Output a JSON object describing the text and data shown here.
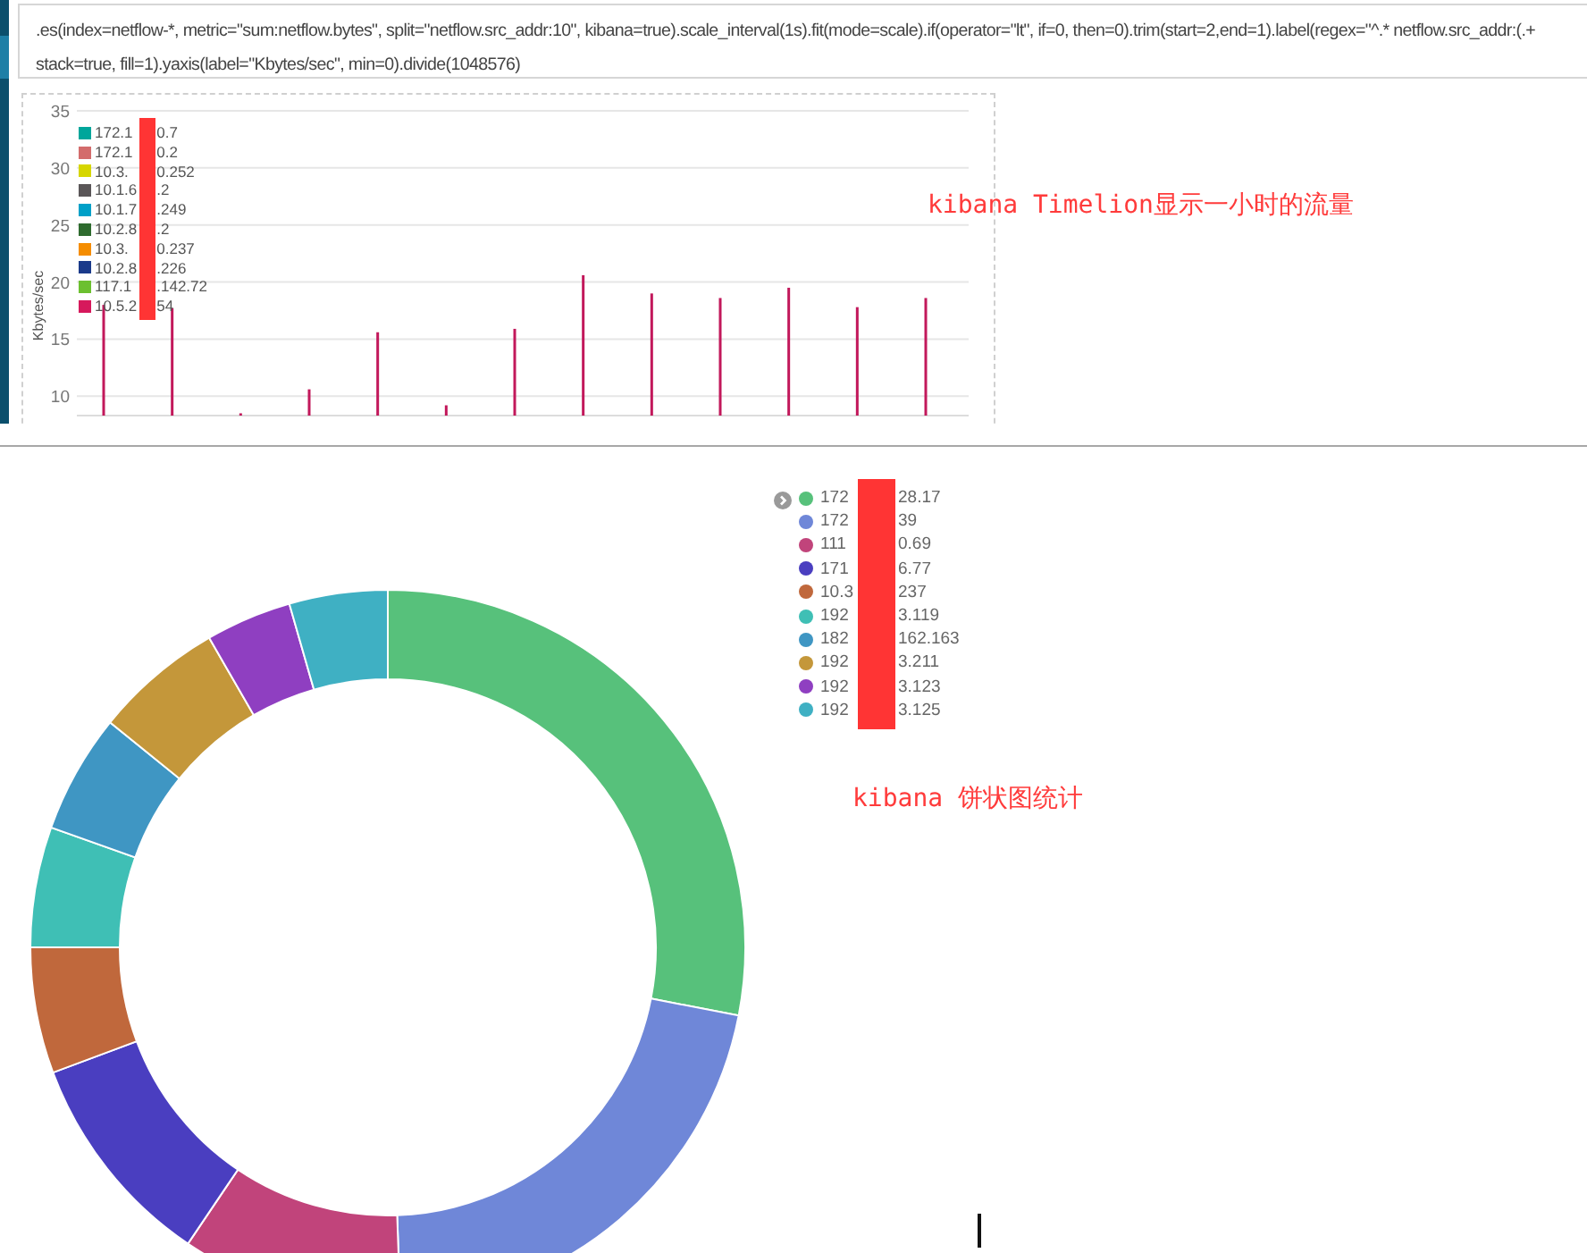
{
  "expression": {
    "lines": [
      ".es(index=netflow-*, metric=\"sum:netflow.bytes\", split=\"netflow.src_addr:10\", kibana=true).scale_interval(1s).fit(mode=scale).if(operator=\"lt\", if=0, then=0).trim(start=2,end=1).label(regex=\"^.* netflow.src_addr:(.+",
      "stack=true, fill=1).yaxis(label=\"Kbytes/sec\", min=0).divide(1048576)"
    ]
  },
  "timelion_chart": {
    "legend": [
      {
        "start": "172.1",
        "end": "0.7",
        "color": "#00a69b"
      },
      {
        "start": "172.1",
        "end": "0.2",
        "color": "#d36c6c"
      },
      {
        "start": "10.3.",
        "end": "0.252",
        "color": "#d6d600"
      },
      {
        "start": "10.1.6",
        "end": ".2",
        "color": "#5a5658"
      },
      {
        "start": "10.1.7",
        "end": ".249",
        "color": "#00a0c8"
      },
      {
        "start": "10.2.8",
        "end": ".2",
        "color": "#2e6b2e"
      },
      {
        "start": "10.3.",
        "end": "0.237",
        "color": "#f58d00"
      },
      {
        "start": "10.2.8",
        "end": ".226",
        "color": "#1a3a8a"
      },
      {
        "start": "117.1",
        "end": ".142.72",
        "color": "#6cc030"
      },
      {
        "start": "10.5.2",
        "end": "54",
        "color": "#d6195c"
      }
    ],
    "chart_data": {
      "type": "bar",
      "ylabel": "Kbytes/sec",
      "categories": [
        null,
        null,
        null,
        null,
        null,
        null,
        null,
        null,
        null,
        null,
        null,
        null,
        null
      ],
      "values": [
        18,
        17.7,
        8.5,
        10.6,
        15.6,
        9.2,
        15.9,
        20.6,
        19,
        18.6,
        19.5,
        17.8,
        18.6
      ],
      "grid": true,
      "ylim": [
        8.3,
        35
      ],
      "yticks": [
        {
          "value": 10,
          "label": "10"
        },
        {
          "value": 15,
          "label": "15"
        },
        {
          "value": 20,
          "label": "20"
        },
        {
          "value": 25,
          "label": "25"
        },
        {
          "value": 30,
          "label": "30"
        },
        {
          "value": 35,
          "label": "35"
        }
      ]
    }
  },
  "timelion_annotation": "kibana Timelion显示一小时的流量",
  "pie": {
    "legend": [
      {
        "start": "172",
        "end": "28.17",
        "color": "#57c17b"
      },
      {
        "start": "172",
        "end": "39",
        "color": "#6f87d8"
      },
      {
        "start": "111",
        "end": "0.69",
        "color": "#c1447b"
      },
      {
        "start": "171",
        "end": "6.77",
        "color": "#4a3ec0"
      },
      {
        "start": "10.3",
        "end": "237",
        "color": "#c0683c"
      },
      {
        "start": "192",
        "end": "3.119",
        "color": "#3fbfb5"
      },
      {
        "start": "182",
        "end": "162.163",
        "color": "#3f96c3"
      },
      {
        "start": "192",
        "end": "3.211",
        "color": "#c4973a"
      },
      {
        "start": "192",
        "end": "3.123",
        "color": "#8f3fc1"
      },
      {
        "start": "192",
        "end": "3.125",
        "color": "#3fb0c3"
      }
    ],
    "annotation": "kibana 饼状图统计"
  }
}
